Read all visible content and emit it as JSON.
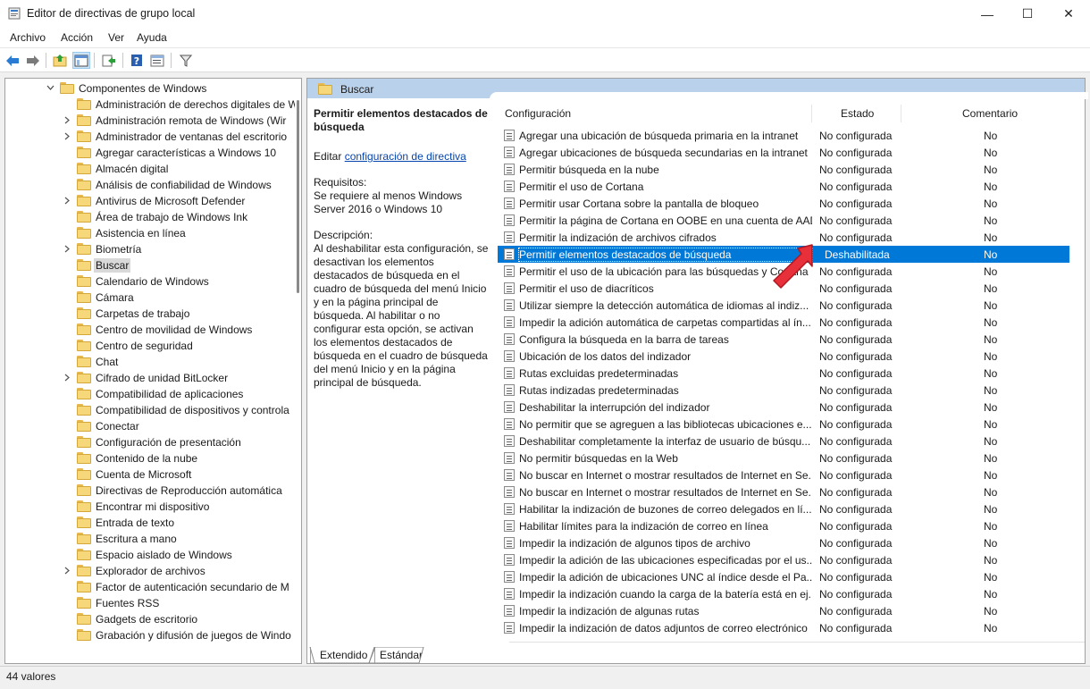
{
  "window": {
    "title": "Editor de directivas de grupo local",
    "minimize_glyph": "—",
    "maximize_glyph": "☐",
    "close_glyph": "✕"
  },
  "menu": [
    "Archivo",
    "Acción",
    "Ver",
    "Ayuda"
  ],
  "toolbar": {
    "icons": [
      "back-arrow-icon",
      "forward-arrow-icon",
      "up-folder-icon",
      "show-hide-tree-icon",
      "export-list-icon",
      "help-icon",
      "properties-icon",
      "filter-icon"
    ]
  },
  "tree": {
    "parent_label": "Componentes de Windows",
    "items": [
      {
        "label": "Administración de derechos digitales de W",
        "expandable": false
      },
      {
        "label": "Administración remota de Windows (Wir",
        "expandable": true
      },
      {
        "label": "Administrador de ventanas del escritorio",
        "expandable": true
      },
      {
        "label": "Agregar características a Windows 10",
        "expandable": false
      },
      {
        "label": "Almacén digital",
        "expandable": false
      },
      {
        "label": "Análisis de confiabilidad de Windows",
        "expandable": false
      },
      {
        "label": "Antivirus de Microsoft Defender",
        "expandable": true
      },
      {
        "label": "Área de trabajo de Windows Ink",
        "expandable": false
      },
      {
        "label": "Asistencia en línea",
        "expandable": false
      },
      {
        "label": "Biometría",
        "expandable": true
      },
      {
        "label": "Buscar",
        "expandable": false,
        "selected": true
      },
      {
        "label": "Calendario de Windows",
        "expandable": false
      },
      {
        "label": "Cámara",
        "expandable": false
      },
      {
        "label": "Carpetas de trabajo",
        "expandable": false
      },
      {
        "label": "Centro de movilidad de Windows",
        "expandable": false
      },
      {
        "label": "Centro de seguridad",
        "expandable": false
      },
      {
        "label": "Chat",
        "expandable": false
      },
      {
        "label": "Cifrado de unidad BitLocker",
        "expandable": true
      },
      {
        "label": "Compatibilidad de aplicaciones",
        "expandable": false
      },
      {
        "label": "Compatibilidad de dispositivos y controla",
        "expandable": false
      },
      {
        "label": "Conectar",
        "expandable": false
      },
      {
        "label": "Configuración de presentación",
        "expandable": false
      },
      {
        "label": "Contenido de la nube",
        "expandable": false
      },
      {
        "label": "Cuenta de Microsoft",
        "expandable": false
      },
      {
        "label": "Directivas de Reproducción automática",
        "expandable": false
      },
      {
        "label": "Encontrar mi dispositivo",
        "expandable": false
      },
      {
        "label": "Entrada de texto",
        "expandable": false
      },
      {
        "label": "Escritura a mano",
        "expandable": false
      },
      {
        "label": "Espacio aislado de Windows",
        "expandable": false
      },
      {
        "label": "Explorador de archivos",
        "expandable": true
      },
      {
        "label": "Factor de autenticación secundario de M",
        "expandable": false
      },
      {
        "label": "Fuentes RSS",
        "expandable": false
      },
      {
        "label": "Gadgets de escritorio",
        "expandable": false
      },
      {
        "label": "Grabación y difusión de juegos de Windo",
        "expandable": false
      }
    ]
  },
  "panel": {
    "header": "Buscar",
    "description": {
      "title": "Permitir elementos destacados de búsqueda",
      "edit_prefix": "Editar",
      "edit_link": "configuración de directiva",
      "requirements_label": "Requisitos:",
      "requirements_text": "Se requiere al menos Windows Server 2016 o Windows 10",
      "description_label": "Descripción:",
      "description_text": "Al deshabilitar esta configuración, se desactivan los elementos destacados de búsqueda en el cuadro de búsqueda del menú Inicio y en la página principal de búsqueda. Al habilitar o no configurar esta opción, se activan los elementos destacados de búsqueda en el cuadro de búsqueda del menú Inicio y en la página principal de búsqueda."
    },
    "columns": {
      "setting": "Configuración",
      "state": "Estado",
      "comment": "Comentario"
    },
    "rows": [
      {
        "name": "Agregar una ubicación de búsqueda primaria en la intranet",
        "state": "No configurada",
        "comment": "No"
      },
      {
        "name": "Agregar ubicaciones de búsqueda secundarias en la intranet",
        "state": "No configurada",
        "comment": "No"
      },
      {
        "name": "Permitir búsqueda en la nube",
        "state": "No configurada",
        "comment": "No"
      },
      {
        "name": "Permitir el uso de Cortana",
        "state": "No configurada",
        "comment": "No"
      },
      {
        "name": "Permitir usar Cortana sobre la pantalla de bloqueo",
        "state": "No configurada",
        "comment": "No"
      },
      {
        "name": "Permitir la página de Cortana en OOBE en una cuenta de AAD",
        "state": "No configurada",
        "comment": "No"
      },
      {
        "name": "Permitir la indización de archivos cifrados",
        "state": "No configurada",
        "comment": "No"
      },
      {
        "name": "Permitir elementos destacados de búsqueda",
        "state": "Deshabilitada",
        "comment": "No",
        "selected": true
      },
      {
        "name": "Permitir el uso de la ubicación para las búsquedas y Cortana",
        "state": "No configurada",
        "comment": "No"
      },
      {
        "name": "Permitir el uso de diacríticos",
        "state": "No configurada",
        "comment": "No"
      },
      {
        "name": "Utilizar siempre la detección automática de idiomas al indiz...",
        "state": "No configurada",
        "comment": "No"
      },
      {
        "name": "Impedir la adición automática de carpetas compartidas al ín...",
        "state": "No configurada",
        "comment": "No"
      },
      {
        "name": "Configura la búsqueda en la barra de tareas",
        "state": "No configurada",
        "comment": "No"
      },
      {
        "name": "Ubicación de los datos del indizador",
        "state": "No configurada",
        "comment": "No"
      },
      {
        "name": "Rutas excluidas predeterminadas",
        "state": "No configurada",
        "comment": "No"
      },
      {
        "name": "Rutas indizadas predeterminadas",
        "state": "No configurada",
        "comment": "No"
      },
      {
        "name": "Deshabilitar la interrupción del indizador",
        "state": "No configurada",
        "comment": "No"
      },
      {
        "name": "No permitir que se agreguen a las bibliotecas ubicaciones e...",
        "state": "No configurada",
        "comment": "No"
      },
      {
        "name": "Deshabilitar completamente la interfaz de usuario de búsqu...",
        "state": "No configurada",
        "comment": "No"
      },
      {
        "name": "No permitir búsquedas en la Web",
        "state": "No configurada",
        "comment": "No"
      },
      {
        "name": "No buscar en Internet o mostrar resultados de Internet en Se...",
        "state": "No configurada",
        "comment": "No"
      },
      {
        "name": "No buscar en Internet o mostrar resultados de Internet en Se...",
        "state": "No configurada",
        "comment": "No"
      },
      {
        "name": "Habilitar la indización de buzones de correo delegados en lí...",
        "state": "No configurada",
        "comment": "No"
      },
      {
        "name": "Habilitar límites para la indización de correo en línea",
        "state": "No configurada",
        "comment": "No"
      },
      {
        "name": "Impedir la indización de algunos tipos de archivo",
        "state": "No configurada",
        "comment": "No"
      },
      {
        "name": "Impedir la adición de las ubicaciones especificadas por el us...",
        "state": "No configurada",
        "comment": "No"
      },
      {
        "name": "Impedir la adición de ubicaciones UNC al índice desde el Pa...",
        "state": "No configurada",
        "comment": "No"
      },
      {
        "name": "Impedir la indización cuando la carga de la batería está en ej...",
        "state": "No configurada",
        "comment": "No"
      },
      {
        "name": "Impedir la indización de algunas rutas",
        "state": "No configurada",
        "comment": "No"
      },
      {
        "name": "Impedir la indización de datos adjuntos de correo electrónico",
        "state": "No configurada",
        "comment": "No"
      }
    ]
  },
  "tabs": [
    "Extendido",
    "Estándar"
  ],
  "status": "44 valores",
  "colors": {
    "selection": "#0078d7",
    "header_band": "#b9d1ea",
    "annotation_arrow": "#e8303a"
  }
}
